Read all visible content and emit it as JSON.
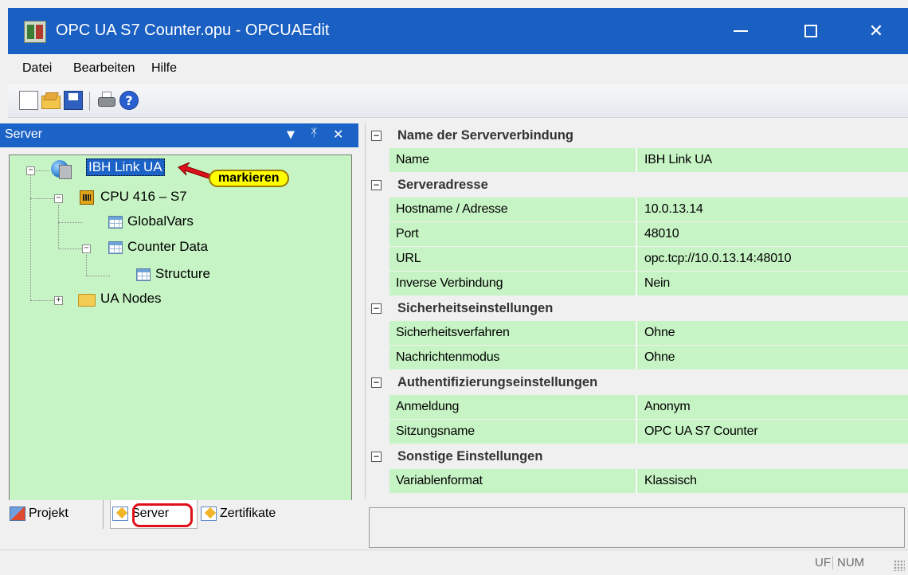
{
  "window": {
    "title": "OPC UA S7 Counter.opu - OPCUAEdit",
    "controls": {
      "minimize": "—",
      "maximize": "☐",
      "close": "✕"
    }
  },
  "menu": {
    "items": [
      {
        "label": "Datei"
      },
      {
        "label": "Bearbeiten"
      },
      {
        "label": "Hilfe"
      }
    ]
  },
  "toolbar": {
    "icons": [
      "new-file-icon",
      "open-folder-icon",
      "save-icon",
      "print-icon",
      "help-icon"
    ],
    "help_glyph": "?"
  },
  "left_panel": {
    "title": "Server",
    "buttons": {
      "dropdown": "▼",
      "pin": "ꟷ",
      "close": "✕"
    },
    "tree": {
      "root": "IBH Link UA",
      "callout": "markieren",
      "cpu": "CPU 416 – S7",
      "globalvars": "GlobalVars",
      "counter_data": "Counter Data",
      "structure": "Structure",
      "ua_nodes": "UA Nodes"
    },
    "tabs": [
      {
        "label": "Projekt"
      },
      {
        "label": "Server"
      },
      {
        "label": "Zertifikate"
      }
    ]
  },
  "properties": {
    "groups": [
      {
        "label": "Name der Serververbindung",
        "toggle": "−",
        "rows": [
          {
            "key": "Name",
            "value": "IBH Link UA"
          }
        ]
      },
      {
        "label": "Serveradresse",
        "toggle": "−",
        "rows": [
          {
            "key": "Hostname / Adresse",
            "value": "10.0.13.14"
          },
          {
            "key": "Port",
            "value": "48010"
          },
          {
            "key": "URL",
            "value": "opc.tcp://10.0.13.14:48010"
          },
          {
            "key": "Inverse Verbindung",
            "value": "Nein"
          }
        ]
      },
      {
        "label": "Sicherheitseinstellungen",
        "toggle": "−",
        "rows": [
          {
            "key": "Sicherheitsverfahren",
            "value": "Ohne"
          },
          {
            "key": "Nachrichtenmodus",
            "value": "Ohne"
          }
        ]
      },
      {
        "label": "Authentifizierungseinstellungen",
        "toggle": "−",
        "rows": [
          {
            "key": "Anmeldung",
            "value": "Anonym"
          },
          {
            "key": "Sitzungsname",
            "value": "OPC UA S7 Counter"
          }
        ]
      },
      {
        "label": "Sonstige Einstellungen",
        "toggle": "−",
        "rows": [
          {
            "key": "Variablenformat",
            "value": "Klassisch"
          }
        ]
      }
    ]
  },
  "statusbar": {
    "uf": "UF",
    "num": "NUM"
  },
  "colors": {
    "titlebar": "#1a5fc2",
    "panel_header": "#1b63c6",
    "grid_green": "#c7f4c5",
    "highlight_red": "#e0101a",
    "callout_yellow": "#ffff00"
  }
}
